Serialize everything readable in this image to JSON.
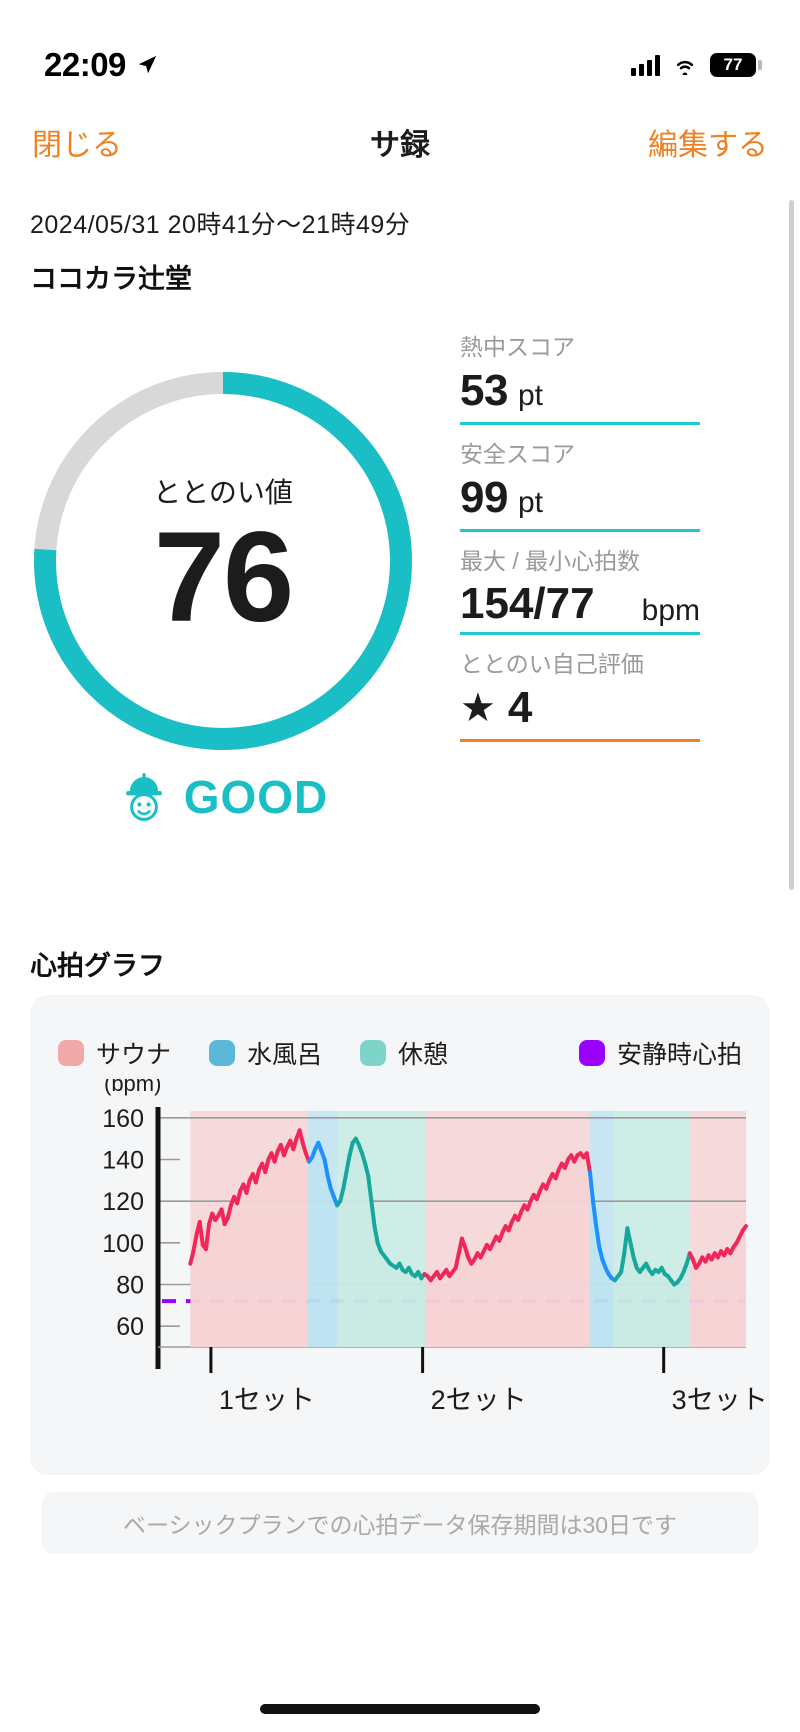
{
  "status_bar": {
    "time": "22:09",
    "battery_percent": "77",
    "icons": [
      "location-arrow-icon",
      "cellular-signal-icon",
      "wifi-icon",
      "battery-icon"
    ]
  },
  "nav": {
    "close_label": "閉じる",
    "title": "サ録",
    "edit_label": "編集する"
  },
  "session": {
    "date_range": "2024/05/31 20時41分〜21時49分",
    "place": "ココカラ辻堂"
  },
  "gauge": {
    "label": "ととのい値",
    "value": "76",
    "percent": 76,
    "verdict": "GOOD",
    "accent_color": "#19BFC4",
    "track_color": "#d8d8d8"
  },
  "stats": [
    {
      "label": "熱中スコア",
      "value": "53",
      "unit": "pt",
      "underline_color": "#1ec8ce"
    },
    {
      "label": "安全スコア",
      "value": "99",
      "unit": "pt",
      "underline_color": "#1ec8ce"
    },
    {
      "label": "最大 / 最小心拍数",
      "value": "154/77",
      "unit": "bpm",
      "underline_color": "#1ec8ce"
    },
    {
      "label": "ととのい自己評価",
      "value": "4",
      "unit": "",
      "star": "★",
      "underline_color": "#F08020"
    }
  ],
  "chart_section": {
    "title": "心拍グラフ",
    "footnote": "ベーシックプランでの心拍データ保存期間は30日です"
  },
  "chart_data": {
    "type": "line",
    "title": "心拍グラフ",
    "xlabel": "",
    "ylabel": "(bpm)",
    "ylim": [
      50,
      170
    ],
    "yticks": [
      60,
      80,
      100,
      120,
      140,
      160
    ],
    "gridlines": [
      80,
      120,
      160
    ],
    "grid": true,
    "legend_position": "top",
    "legend": [
      {
        "name": "サウナ",
        "color": "#F0A8A8"
      },
      {
        "name": "水風呂",
        "color": "#5BB8D8"
      },
      {
        "name": "休憩",
        "color": "#7DD4C8"
      },
      {
        "name": "安静時心拍",
        "color": "#9900FF"
      }
    ],
    "x_tick_labels": [
      "1セット",
      "2セット",
      "3セット"
    ],
    "x_tick_positions": [
      0.09,
      0.45,
      0.86
    ],
    "resting_hr": 72,
    "resting_hr_style": "dashed",
    "bands": [
      {
        "type": "サウナ",
        "color": "#F6D4D6",
        "x_start": 0.055,
        "x_end": 0.255
      },
      {
        "type": "水風呂",
        "color": "#BEE3F0",
        "x_start": 0.255,
        "x_end": 0.305
      },
      {
        "type": "休憩",
        "color": "#C8EBE4",
        "x_start": 0.305,
        "x_end": 0.455
      },
      {
        "type": "サウナ",
        "color": "#F6D4D6",
        "x_start": 0.455,
        "x_end": 0.735
      },
      {
        "type": "水風呂",
        "color": "#BEE3F0",
        "x_start": 0.735,
        "x_end": 0.775
      },
      {
        "type": "休憩",
        "color": "#C8EBE4",
        "x_start": 0.775,
        "x_end": 0.905
      },
      {
        "type": "サウナ",
        "color": "#F6D4D6",
        "x_start": 0.905,
        "x_end": 1.0
      }
    ],
    "series": [
      {
        "name": "心拍数",
        "unit": "bpm",
        "segment_colors": {
          "sauna": "#F0285A",
          "water": "#1E90FF",
          "rest": "#17A79C"
        },
        "values": [
          90,
          96,
          104,
          110,
          99,
          97,
          109,
          114,
          111,
          113,
          116,
          109,
          112,
          118,
          122,
          119,
          125,
          128,
          124,
          130,
          133,
          129,
          135,
          138,
          134,
          140,
          143,
          139,
          144,
          147,
          142,
          146,
          149,
          145,
          150,
          154,
          148,
          143,
          139,
          141,
          145,
          148,
          144,
          140,
          132,
          126,
          122,
          118,
          120,
          126,
          134,
          142,
          148,
          150,
          147,
          143,
          138,
          132,
          120,
          108,
          100,
          96,
          94,
          92,
          90,
          89,
          88,
          90,
          87,
          86,
          88,
          85,
          84,
          86,
          83,
          85,
          84,
          82,
          84,
          86,
          83,
          85,
          87,
          84,
          86,
          88,
          95,
          102,
          98,
          93,
          90,
          92,
          95,
          93,
          96,
          99,
          97,
          100,
          103,
          101,
          105,
          108,
          106,
          110,
          113,
          111,
          115,
          118,
          116,
          120,
          123,
          121,
          125,
          128,
          126,
          130,
          133,
          131,
          135,
          138,
          136,
          140,
          142,
          139,
          142,
          143,
          141,
          143,
          134,
          120,
          108,
          98,
          92,
          88,
          85,
          83,
          82,
          84,
          86,
          95,
          107,
          100,
          93,
          88,
          86,
          88,
          90,
          87,
          85,
          87,
          86,
          88,
          85,
          84,
          82,
          80,
          81,
          83,
          86,
          90,
          95,
          92,
          88,
          90,
          93,
          91,
          94,
          92,
          95,
          93,
          96,
          94,
          97,
          95,
          98,
          100,
          103,
          106,
          108
        ]
      }
    ]
  }
}
